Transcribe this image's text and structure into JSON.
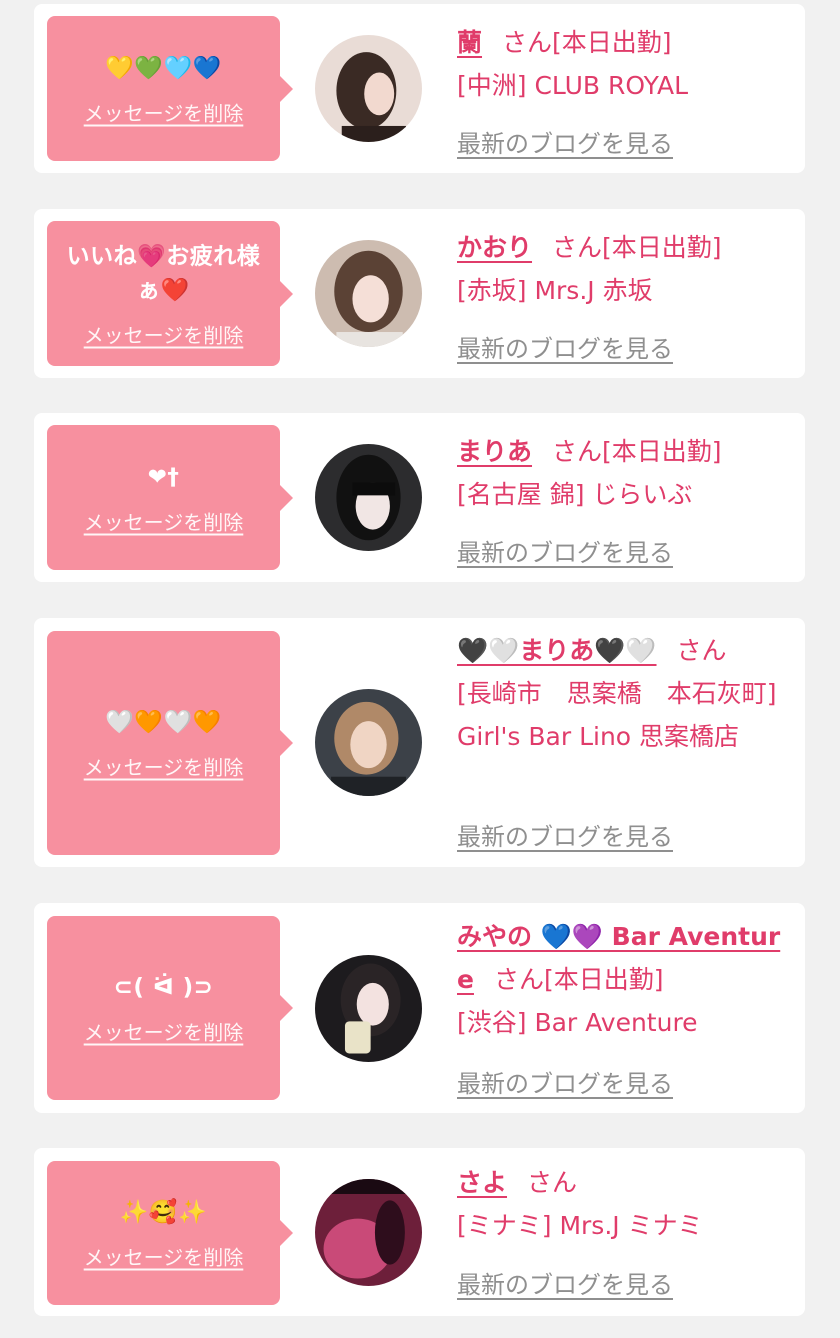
{
  "delete_label": "メッセージを削除",
  "blog_label": "最新のブログを見る",
  "colors": {
    "accent": "#e03c6a",
    "bubble": "#f7909f",
    "background": "#f1f1f1",
    "card": "#ffffff",
    "link_gray": "#8f8f8f"
  },
  "entries": [
    {
      "message": "💛💚🩵💙",
      "name": "蘭",
      "san": "さん",
      "attendance": "[本日出勤]",
      "shop": "[中洲] CLUB ROYAL"
    },
    {
      "message": "いいね💗お疲れ様ぁ❤️",
      "name": "かおり",
      "san": "さん",
      "attendance": "[本日出勤]",
      "shop": "[赤坂] Mrs.J 赤坂"
    },
    {
      "message": "❤︎†",
      "name": "まりあ",
      "san": "さん",
      "attendance": "[本日出勤]",
      "shop": "[名古屋 錦] じらいぶ"
    },
    {
      "message": "🤍🧡🤍🧡",
      "name": "🖤🤍まりあ🖤🤍",
      "san": "さん",
      "attendance": "",
      "shop": "[長崎市　思案橋　本石灰町] Girl's Bar Lino 思案橋店"
    },
    {
      "message": "⊂( ᐛ )⊃",
      "name": "みやの 💙💜 Bar Aventure",
      "san": "さん",
      "attendance": "[本日出勤]",
      "shop": "[渋谷] Bar Aventure"
    },
    {
      "message": "✨🥰✨",
      "name": "さよ",
      "san": "さん",
      "attendance": "",
      "shop": "[ミナミ] Mrs.J ミナミ"
    }
  ]
}
